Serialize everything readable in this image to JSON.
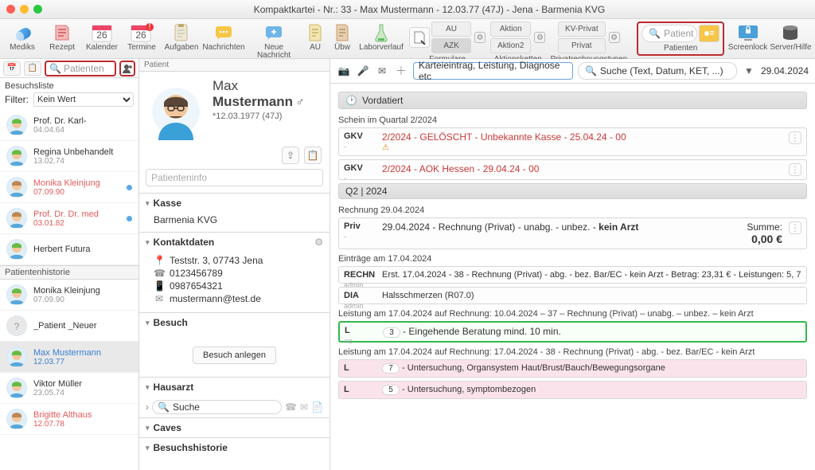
{
  "window": {
    "title": "Kompaktkartei - Nr.: 33 - Max Mustermann - 12.03.77 (47J) - Jena - Barmenia KVG"
  },
  "toolbar": {
    "mediks": "Mediks",
    "rezept": "Rezept",
    "kalender": "Kalender",
    "kalender_day": "26",
    "termine": "Termine",
    "termine_day": "26",
    "aufgaben": "Aufgaben",
    "nachrichten": "Nachrichten",
    "neue_nachricht": "Neue Nachricht",
    "au": "AU",
    "uebw": "Übw",
    "laborverlauf": "Laborverlauf",
    "formulare_group": "Formulare",
    "form_top": "AU",
    "form_bot": "AZK",
    "aktionsketten_group": "Aktionsketten",
    "ak_top": "Aktion",
    "ak_bot": "Aktion2",
    "privatrechnung_group": "Privatrechnungstypen",
    "pr_top": "KV-Privat",
    "pr_bot": "Privat",
    "patienten_group": "Patienten",
    "patient_search_placeholder": "Patient",
    "screenlock": "Screenlock",
    "serverhelp": "Server/Hilfe"
  },
  "left": {
    "search_placeholder": "Patienten",
    "section1": "Besuchsliste",
    "filter_label": "Filter:",
    "filter_value": "Kein Wert",
    "visits": [
      {
        "name": "Prof. Dr. Karl-",
        "dob": "04.04.64",
        "style": ""
      },
      {
        "name": "Regina Unbehandelt",
        "dob": "13.02.74",
        "style": ""
      },
      {
        "name": "Monika Kleinjung",
        "dob": "07.09.90",
        "style": "red",
        "dot": true
      },
      {
        "name": "Prof. Dr. Dr. med",
        "dob": "03.01.82",
        "style": "red",
        "dot": true
      },
      {
        "name": "Herbert Futura",
        "dob": "",
        "style": ""
      }
    ],
    "section2": "Patientenhistorie",
    "history": [
      {
        "name": "Monika Kleinjung",
        "dob": "07.09.90",
        "style": ""
      },
      {
        "name": "_Patient _Neuer",
        "dob": "",
        "style": "",
        "unknown": true
      },
      {
        "name": "Max Mustermann",
        "dob": "12.03.77",
        "style": "blue",
        "selected": true
      },
      {
        "name": "Viktor Müller",
        "dob": "23.05.74",
        "style": ""
      },
      {
        "name": "Brigitte Althaus",
        "dob": "12.07.78",
        "style": "red"
      }
    ]
  },
  "patient": {
    "header_label": "Patient",
    "first": "Max",
    "last": "Mustermann",
    "dob_line": "*12.03.1977 (47J)",
    "info_placeholder": "Patienteninfo",
    "sections": {
      "kasse": "Kasse",
      "kasse_value": "Barmenia KVG",
      "kontakt": "Kontaktdaten",
      "addr": "Teststr. 3, 07743 Jena",
      "tel": "0123456789",
      "mob": "0987654321",
      "mail": "mustermann@test.de",
      "besuch": "Besuch",
      "besuch_btn": "Besuch anlegen",
      "hausarzt": "Hausarzt",
      "hausarzt_search": "Suche",
      "caves": "Caves",
      "besuchshistorie": "Besuchshistorie"
    }
  },
  "timeline": {
    "input_placeholder": "Karteieintrag, Leistung, Diagnose etc",
    "search_placeholder": "Suche (Text, Datum, KET, ...)",
    "date": "29.04.2024",
    "band_vordatiert": "Vordatiert",
    "schein_hdr": "Schein im Quartal 2/2024",
    "schein": [
      {
        "tag": "GKV",
        "sub": "-",
        "text": "2/2024 - GELÖSCHT - Unbekannte Kasse - 25.04.24 - 00",
        "warn": true
      },
      {
        "tag": "GKV",
        "sub": "-",
        "text": "2/2024 - AOK Hessen - 29.04.24 - 00"
      }
    ],
    "band_q2": "Q2 | 2024",
    "rechnung_hdr": "Rechnung 29.04.2024",
    "rechnung": {
      "tag": "Priv",
      "sub": "-",
      "text_pre": "29.04.2024 - Rechnung (Privat) - unabg. - unbez. - ",
      "text_bold": "kein Arzt",
      "sum_lbl": "Summe:",
      "sum_val": "0,00 €"
    },
    "eintraege_hdr": "Einträge am 17.04.2024",
    "eintraege": [
      {
        "tag": "RECHN",
        "sub": "admin",
        "text": "Erst. 17.04.2024 - 38 - Rechnung (Privat) - abg. - bez. Bar/EC - kein Arzt - Betrag: 23,31 € - Leistungen: 5, 7"
      },
      {
        "tag": "DIA",
        "sub": "admin",
        "text": "Halsschmerzen (R07.0)"
      }
    ],
    "leist1_hdr": "Leistung am 17.04.2024 auf Rechnung: 10.04.2024 – 37 – Rechnung (Privat) – unabg. – unbez. – kein Arzt",
    "leist1": {
      "tag": "L",
      "sub": "no",
      "chip": "3",
      "text": "- Eingehende Beratung mind. 10 min."
    },
    "leist2_hdr": "Leistung am 17.04.2024 auf Rechnung: 17.04.2024 - 38 - Rechnung (Privat) - abg. - bez. Bar/EC - kein Arzt",
    "leist2": [
      {
        "tag": "L",
        "sub": "",
        "chip": "7",
        "text": "- Untersuchung, Organsystem Haut/Brust/Bauch/Bewegungsorgane"
      },
      {
        "tag": "L",
        "sub": "",
        "chip": "5",
        "text": "- Untersuchung, symptombezogen"
      }
    ]
  }
}
